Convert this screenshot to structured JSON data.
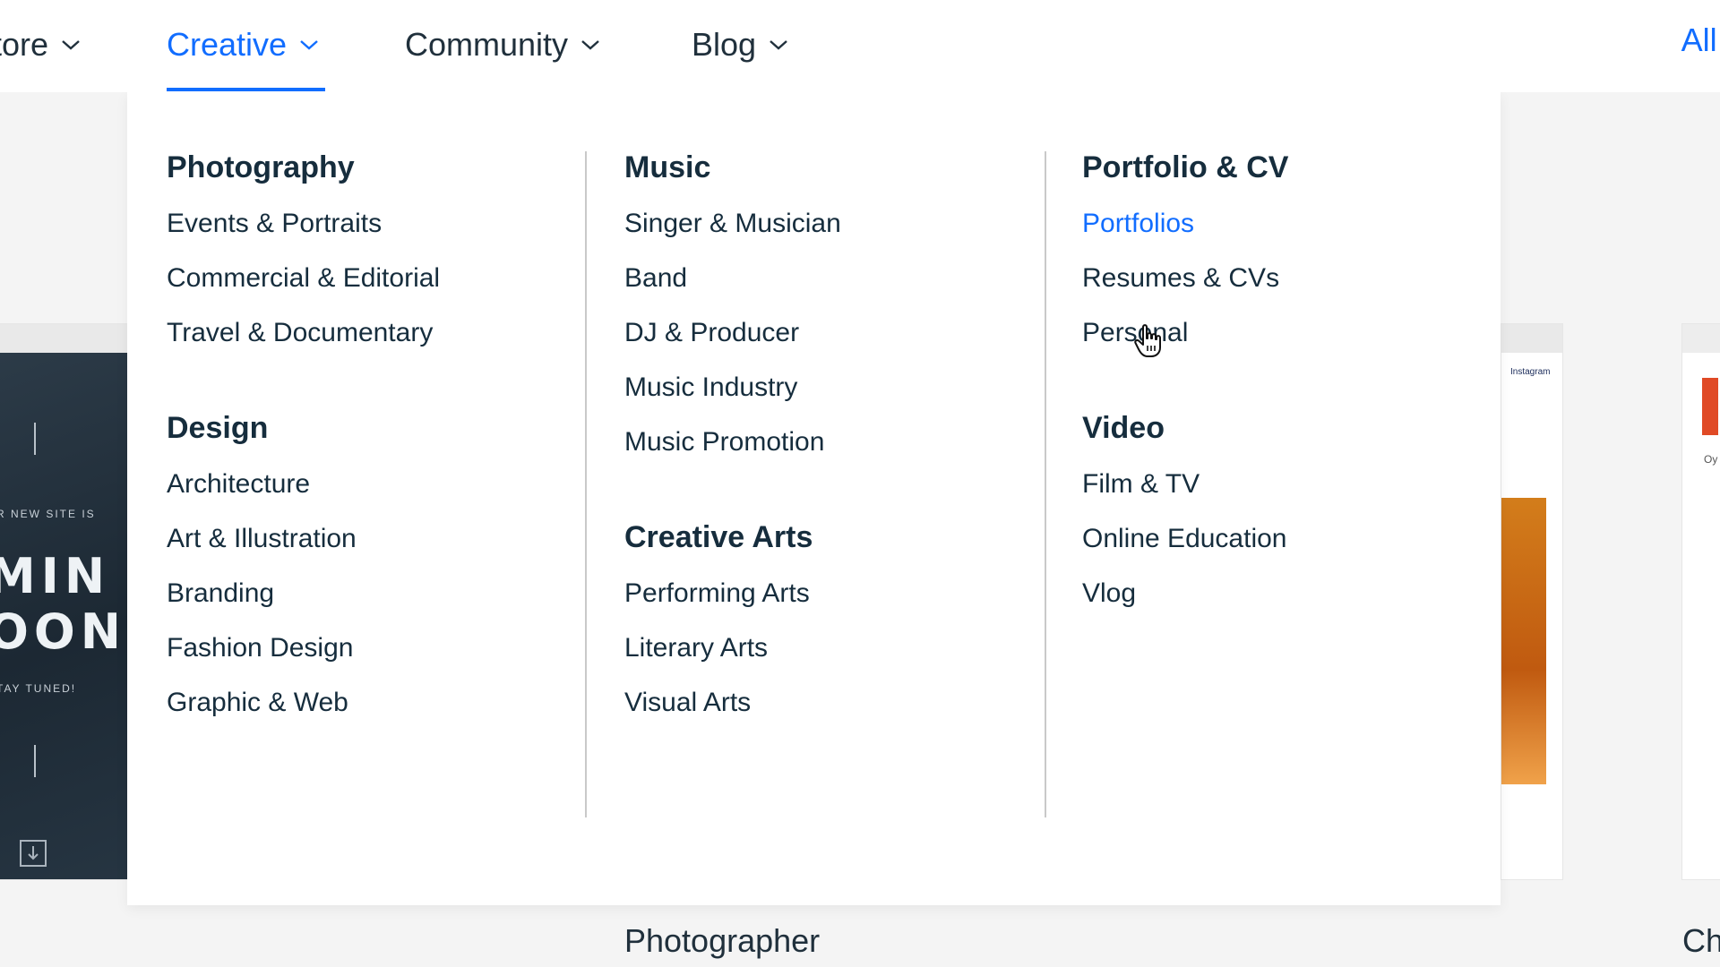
{
  "topnav": {
    "items": [
      {
        "label": "tore",
        "active": false
      },
      {
        "label": "Creative",
        "active": true
      },
      {
        "label": "Community",
        "active": false
      },
      {
        "label": "Blog",
        "active": false
      }
    ],
    "all_link": "All T",
    "icon": "chevron-down-icon",
    "accent_color": "#116dff"
  },
  "menu": {
    "columns": [
      {
        "groups": [
          {
            "heading": "Photography",
            "links": [
              "Events & Portraits",
              "Commercial & Editorial",
              "Travel & Documentary"
            ]
          },
          {
            "heading": "Design",
            "links": [
              "Architecture",
              "Art & Illustration",
              "Branding",
              "Fashion Design",
              "Graphic & Web"
            ]
          }
        ]
      },
      {
        "groups": [
          {
            "heading": "Music",
            "links": [
              "Singer & Musician",
              "Band",
              "DJ & Producer",
              "Music Industry",
              "Music Promotion"
            ]
          },
          {
            "heading": "Creative Arts",
            "links": [
              "Performing Arts",
              "Literary Arts",
              "Visual Arts"
            ]
          }
        ]
      },
      {
        "groups": [
          {
            "heading": "Portfolio & CV",
            "links": [
              "Portfolios",
              "Resumes & CVs",
              "Personal"
            ]
          },
          {
            "heading": "Video",
            "links": [
              "Film & TV",
              "Online Education",
              "Vlog"
            ]
          }
        ]
      }
    ],
    "hovered_link": "Portfolios"
  },
  "background": {
    "left_card": {
      "line1": "R NEW SITE IS",
      "line2": "MIN",
      "line3": "OON",
      "line4": "TAY TUNED!"
    },
    "right_card_1": {
      "label": "Instagram"
    },
    "right_card_2": {
      "label": "Oy"
    },
    "below_labels": [
      "Photographer",
      "Ch"
    ]
  }
}
